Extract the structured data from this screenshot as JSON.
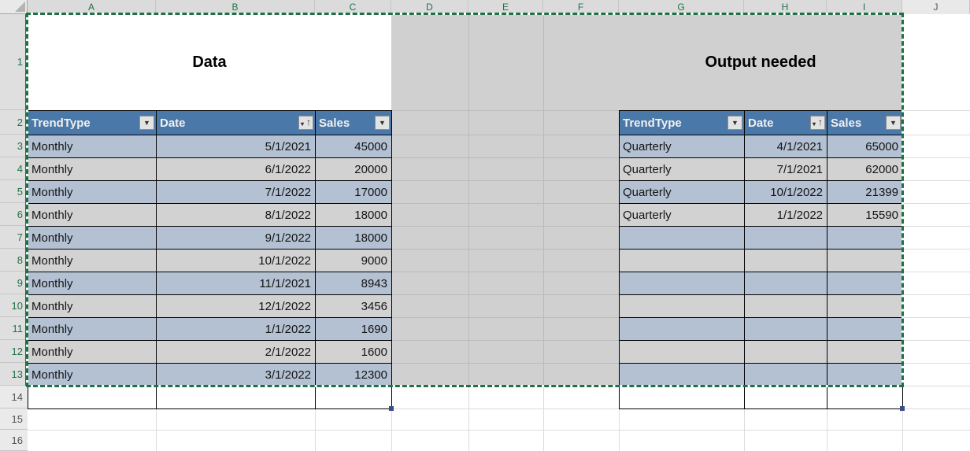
{
  "columns": [
    {
      "letter": "A",
      "selected": true
    },
    {
      "letter": "B",
      "selected": true
    },
    {
      "letter": "C",
      "selected": true
    },
    {
      "letter": "D",
      "selected": true
    },
    {
      "letter": "E",
      "selected": true
    },
    {
      "letter": "F",
      "selected": true
    },
    {
      "letter": "G",
      "selected": true
    },
    {
      "letter": "H",
      "selected": true
    },
    {
      "letter": "I",
      "selected": true
    },
    {
      "letter": "J",
      "selected": false
    }
  ],
  "row_headers": [
    {
      "number": "1",
      "selected": true
    },
    {
      "number": "2",
      "selected": true
    },
    {
      "number": "3",
      "selected": true
    },
    {
      "number": "4",
      "selected": true
    },
    {
      "number": "5",
      "selected": true
    },
    {
      "number": "6",
      "selected": true
    },
    {
      "number": "7",
      "selected": true
    },
    {
      "number": "8",
      "selected": true
    },
    {
      "number": "9",
      "selected": true
    },
    {
      "number": "10",
      "selected": true
    },
    {
      "number": "11",
      "selected": true
    },
    {
      "number": "12",
      "selected": true
    },
    {
      "number": "13",
      "selected": true
    },
    {
      "number": "14",
      "selected": false
    },
    {
      "number": "15",
      "selected": false
    },
    {
      "number": "16",
      "selected": false
    }
  ],
  "left_table": {
    "title": "Data",
    "headers": [
      {
        "label": "TrendType",
        "icon": "filter-dropdown-icon"
      },
      {
        "label": "Date",
        "icon": "sort-ascending-filter-icon"
      },
      {
        "label": "Sales",
        "icon": "filter-dropdown-icon"
      }
    ],
    "rows": [
      {
        "trend": "Monthly",
        "date": "5/1/2021",
        "sales": "45000"
      },
      {
        "trend": "Monthly",
        "date": "6/1/2022",
        "sales": "20000"
      },
      {
        "trend": "Monthly",
        "date": "7/1/2022",
        "sales": "17000"
      },
      {
        "trend": "Monthly",
        "date": "8/1/2022",
        "sales": "18000"
      },
      {
        "trend": "Monthly",
        "date": "9/1/2022",
        "sales": "18000"
      },
      {
        "trend": "Monthly",
        "date": "10/1/2022",
        "sales": "9000"
      },
      {
        "trend": "Monthly",
        "date": "11/1/2021",
        "sales": "8943"
      },
      {
        "trend": "Monthly",
        "date": "12/1/2022",
        "sales": "3456"
      },
      {
        "trend": "Monthly",
        "date": "1/1/2022",
        "sales": "1690"
      },
      {
        "trend": "Monthly",
        "date": "2/1/2022",
        "sales": "1600"
      },
      {
        "trend": "Monthly",
        "date": "3/1/2022",
        "sales": "12300"
      }
    ]
  },
  "right_table": {
    "title": "Output needed",
    "headers": [
      {
        "label": "TrendType",
        "icon": "filter-dropdown-icon"
      },
      {
        "label": "Date",
        "icon": "sort-ascending-filter-icon"
      },
      {
        "label": "Sales",
        "icon": "filter-dropdown-icon"
      }
    ],
    "rows": [
      {
        "trend": "Quarterly",
        "date": "4/1/2021",
        "sales": "65000"
      },
      {
        "trend": "Quarterly",
        "date": "7/1/2021",
        "sales": "62000"
      },
      {
        "trend": "Quarterly",
        "date": "10/1/2022",
        "sales": "21399"
      },
      {
        "trend": "Quarterly",
        "date": "1/1/2022",
        "sales": "15590"
      },
      {
        "trend": "",
        "date": "",
        "sales": ""
      },
      {
        "trend": "",
        "date": "",
        "sales": ""
      },
      {
        "trend": "",
        "date": "",
        "sales": ""
      },
      {
        "trend": "",
        "date": "",
        "sales": ""
      },
      {
        "trend": "",
        "date": "",
        "sales": ""
      },
      {
        "trend": "",
        "date": "",
        "sales": ""
      },
      {
        "trend": "",
        "date": "",
        "sales": ""
      }
    ]
  },
  "icons": {
    "filter_dropdown": "▼",
    "sort_down": "▾",
    "sort_up": "↑"
  },
  "colors": {
    "header_blue": "#4A78A8",
    "header_text": "#F1F1F1",
    "band_blue": "#B3C1D3",
    "band_gray": "#D3D2D2",
    "fill_gray": "#D1D0D0",
    "marquee_green": "#1E7145",
    "selection_green": "#217346",
    "handle_blue": "#3B4E87"
  }
}
